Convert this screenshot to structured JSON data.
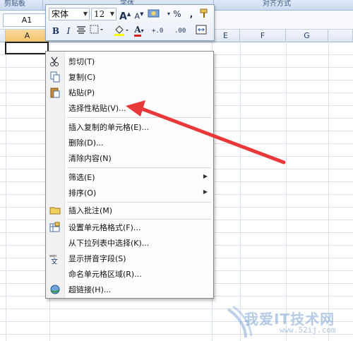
{
  "ribbon": {
    "groups": [
      "剪贴板",
      "字体",
      "对齐方式"
    ]
  },
  "name_box": {
    "value": "A1"
  },
  "columns": [
    "A",
    "E",
    "F",
    "G"
  ],
  "mini_toolbar": {
    "font_name": "宋体",
    "font_size": "12",
    "grow_font": "A",
    "shrink_font": "A",
    "percent": "%",
    "comma": ",",
    "bold": "B",
    "italic": "I",
    "font_color": "A",
    "inc_decimal": "+.0",
    "dec_decimal": ".00"
  },
  "context_menu": {
    "items": [
      {
        "label": "剪切(T)",
        "icon": "scissors-icon"
      },
      {
        "label": "复制(C)",
        "icon": "copy-icon"
      },
      {
        "label": "粘贴(P)",
        "icon": "paste-icon"
      },
      {
        "label": "选择性粘贴(V)...",
        "icon": ""
      },
      {
        "label": "插入复制的单元格(E)...",
        "icon": ""
      },
      {
        "label": "删除(D)...",
        "icon": ""
      },
      {
        "label": "清除内容(N)",
        "icon": ""
      },
      {
        "label": "筛选(E)",
        "icon": "",
        "submenu": true
      },
      {
        "label": "排序(O)",
        "icon": "",
        "submenu": true
      },
      {
        "label": "插入批注(M)",
        "icon": "comment-icon"
      },
      {
        "label": "设置单元格格式(F)...",
        "icon": "format-cells-icon"
      },
      {
        "label": "从下拉列表中选择(K)...",
        "icon": ""
      },
      {
        "label": "显示拼音字段(S)",
        "icon": "phonetic-icon"
      },
      {
        "label": "命名单元格区域(R)...",
        "icon": ""
      },
      {
        "label": "超链接(H)...",
        "icon": "hyperlink-icon"
      }
    ]
  },
  "watermark": {
    "text": "我爱IT技术网",
    "url": "www.52ij.com"
  },
  "colors": {
    "annotation_arrow": "#e8383a",
    "selection_header": "#f2c46d"
  }
}
